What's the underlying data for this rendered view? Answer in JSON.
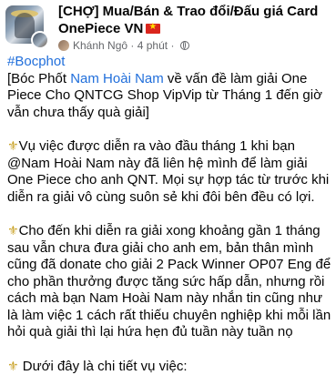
{
  "post": {
    "group_name": "[CHỢ] Mua/Bán & Trao đổi/Đấu giá Card OnePiece VN",
    "author": "Khánh Ngô",
    "separator": "·",
    "time": "4 phút",
    "hashtag": "#Bocphot",
    "intro_pre": "[Bóc Phốt ",
    "intro_name": "Nam Hoài Nam",
    "intro_post": " về vấn đề làm giải One Piece Cho QNTCG Shop VipVip từ Tháng 1 đến giờ vẫn chưa thấy quà giải]",
    "bullet_icon": "⚜",
    "para1": "Vụ việc được diễn ra vào đầu tháng 1 khi bạn @Nam Hoài Nam này đã liên hệ mình để làm giải One Piece cho anh QNT. Mọi sự hợp tác từ trước khi diễn ra giải vô cùng suôn sẻ khi đôi bên đều có lợi.",
    "para2": "Cho đến khi diễn ra giải xong khoảng gần 1 tháng sau vẫn chưa đưa giải cho anh em, bản thân mình cũng đã donate cho giải 2 Pack Winner OP07 Eng để cho phần thưởng được tăng sức hấp dẫn, nhưng rồi cách mà bạn Nam Hoài Nam này nhắn tin cũng như là làm việc 1 cách rất thiếu chuyên nghiệp khi mỗi lần hỏi quà giải thì lại hứa hẹn đủ tuần này tuần nọ",
    "para3": "Dưới đây là chi tiết vụ việc:"
  },
  "icons": {
    "flag": "vietnam-flag-icon",
    "privacy": "globe-icon",
    "bullet": "fleur-de-lis-icon"
  },
  "colors": {
    "link": "#216fdb",
    "meta": "#65676b",
    "text": "#050505"
  }
}
